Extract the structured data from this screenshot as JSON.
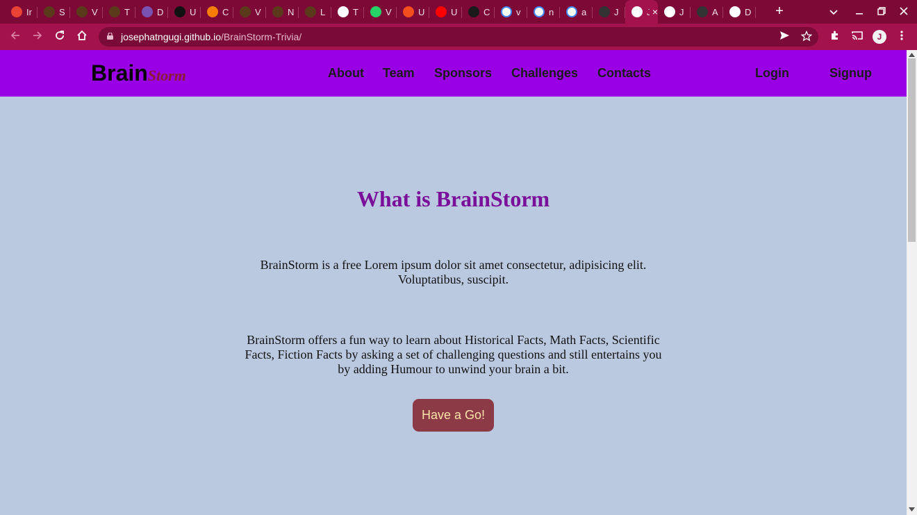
{
  "browser": {
    "tabs": [
      {
        "title": "Ir",
        "icon": "gmail-icon",
        "color": "#ea4335"
      },
      {
        "title": "S",
        "icon": "plant-icon",
        "color": "#5a3a1a"
      },
      {
        "title": "V",
        "icon": "plant-icon",
        "color": "#5a3a1a"
      },
      {
        "title": "T",
        "icon": "plant-icon",
        "color": "#5a3a1a"
      },
      {
        "title": "D",
        "icon": "bootstrap-icon",
        "color": "#7952b3"
      },
      {
        "title": "U",
        "icon": "codepen-icon",
        "color": "#111111"
      },
      {
        "title": "C",
        "icon": "blogger-icon",
        "color": "#f57d00"
      },
      {
        "title": "V",
        "icon": "plant-icon",
        "color": "#5a3a1a"
      },
      {
        "title": "N",
        "icon": "plant-icon",
        "color": "#5a3a1a"
      },
      {
        "title": "L",
        "icon": "plant-icon",
        "color": "#5a3a1a"
      },
      {
        "title": "T",
        "icon": "globe-icon",
        "color": "#ffffff"
      },
      {
        "title": "V",
        "icon": "whatsapp-icon",
        "color": "#25d366"
      },
      {
        "title": "U",
        "icon": "figma-icon",
        "color": "#f24e1e"
      },
      {
        "title": "U",
        "icon": "youtube-icon",
        "color": "#ff0000"
      },
      {
        "title": "C",
        "icon": "wordpress-icon",
        "color": "#1a1a1a"
      },
      {
        "title": "v",
        "icon": "google-icon",
        "color": "#ffffff"
      },
      {
        "title": "n",
        "icon": "google-icon",
        "color": "#ffffff"
      },
      {
        "title": "a",
        "icon": "google-icon",
        "color": "#ffffff"
      },
      {
        "title": "J",
        "icon": "github-icon",
        "color": "#333333"
      },
      {
        "title": "J",
        "icon": "globe-icon",
        "color": "#ffffff",
        "active": true
      },
      {
        "title": "J",
        "icon": "globe-icon",
        "color": "#ffffff"
      },
      {
        "title": "A",
        "icon": "github-icon",
        "color": "#333333"
      },
      {
        "title": "D",
        "icon": "globe-icon",
        "color": "#ffffff"
      }
    ],
    "url_host": "josephatngugi.github.io",
    "url_path": "/BrainStorm-Trivia/",
    "profile_initial": "J"
  },
  "site": {
    "logo_main": "Brain",
    "logo_accent": "Storm",
    "nav": {
      "about": "About",
      "team": "Team",
      "sponsors": "Sponsors",
      "challenges": "Challenges",
      "contacts": "Contacts",
      "login": "Login",
      "signup": "Signup"
    },
    "hero_title": "What is BrainStorm",
    "para1": "BrainStorm is a free Lorem ipsum dolor sit amet consectetur, adipisicing elit. Voluptatibus, suscipit.",
    "para2": "BrainStorm offers a fun way to learn about Historical Facts, Math Facts, Scientific Facts, Fiction Facts by asking a set of challenging questions and still entertains you by adding Humour to unwind your brain a bit.",
    "cta": "Have a Go!"
  },
  "colors": {
    "tabstrip": "#7d0a36",
    "toolbar": "#a3124d",
    "site_nav": "#9900e6",
    "page_bg": "#bac8e0",
    "title": "#7a0f99",
    "cta_bg": "#8d3a47"
  }
}
